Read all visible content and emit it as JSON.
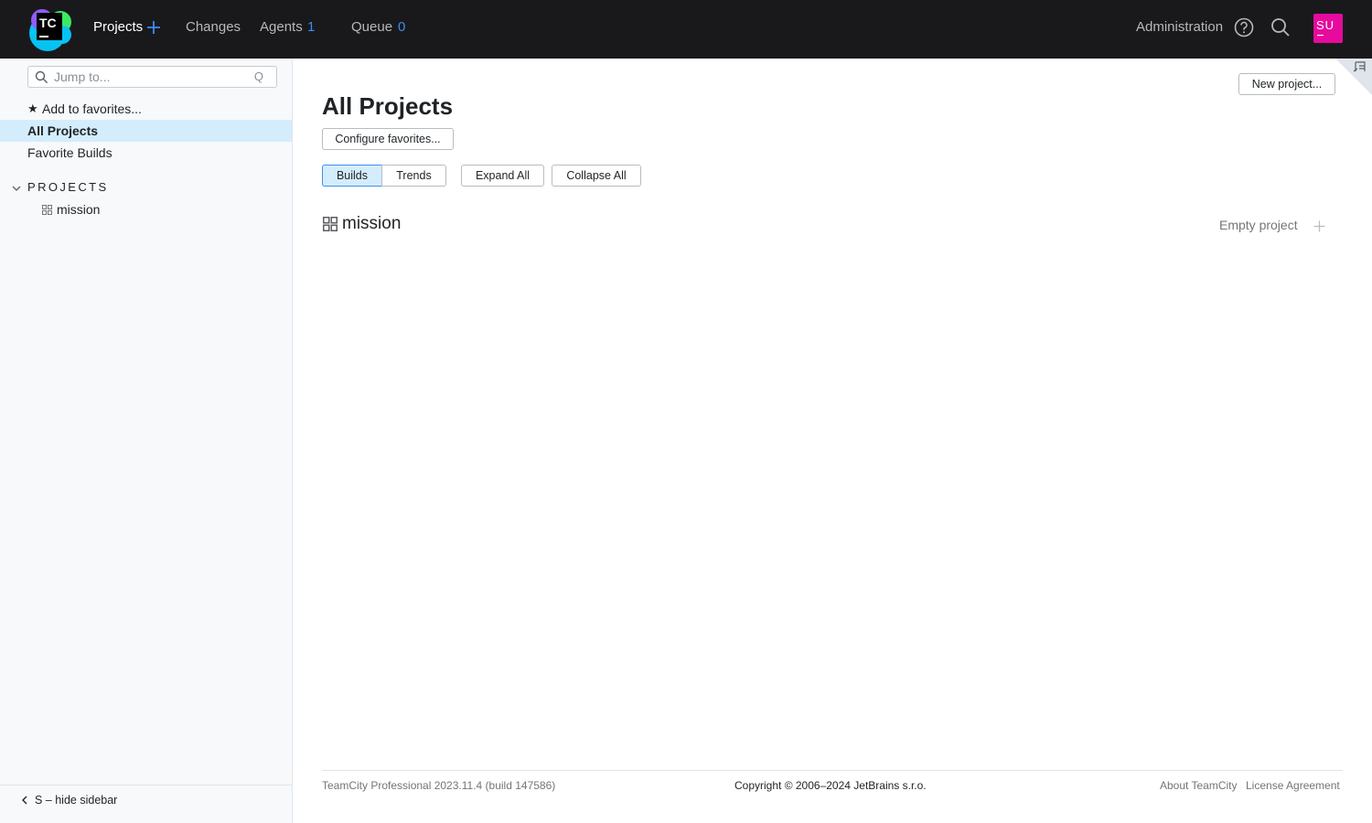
{
  "header": {
    "logo_text": "TC",
    "nav": {
      "projects": "Projects",
      "changes": "Changes",
      "agents": "Agents",
      "agents_count": "1",
      "queue": "Queue",
      "queue_count": "0"
    },
    "administration": "Administration",
    "avatar_initials": "SU",
    "icons": [
      "plus-icon",
      "help-icon",
      "search-icon"
    ]
  },
  "sidebar": {
    "search_placeholder": "Jump to...",
    "search_shortcut": "Q",
    "add_favorites": "Add to favorites...",
    "all_projects": "All Projects",
    "favorite_builds": "Favorite Builds",
    "section_title": "PROJECTS",
    "projects": [
      {
        "name": "mission"
      }
    ],
    "hide_sidebar": "S – hide sidebar"
  },
  "main": {
    "new_project": "New project...",
    "title": "All Projects",
    "configure_favorites": "Configure favorites...",
    "tabs": [
      {
        "label": "Builds",
        "selected": true
      },
      {
        "label": "Trends",
        "selected": false
      }
    ],
    "expand_all": "Expand All",
    "collapse_all": "Collapse All",
    "project_rows": [
      {
        "name": "mission",
        "status": "Empty project"
      }
    ]
  },
  "footer": {
    "version": "TeamCity Professional 2023.11.4 (build 147586)",
    "copyright": "Copyright © 2006–2024 JetBrains s.r.o.",
    "about": "About TeamCity",
    "license": "License Agreement"
  },
  "colors": {
    "header_bg": "#19191c",
    "accent": "#3d8df5",
    "avatar": "#e60a9d",
    "selected_bg": "#d4edfc",
    "sidebar_bg": "#f7f9fa"
  }
}
